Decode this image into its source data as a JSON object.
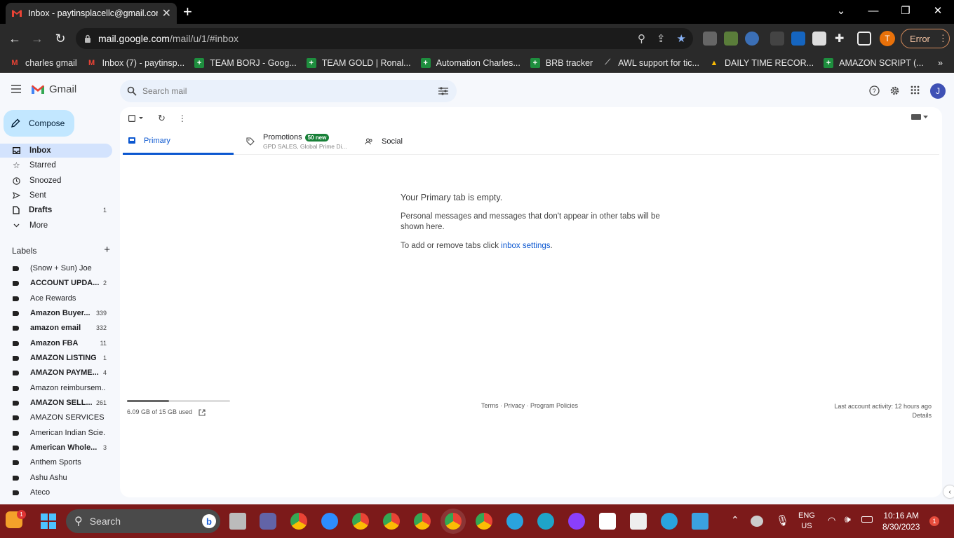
{
  "browser": {
    "tab_title": "Inbox - paytinsplacellc@gmail.com",
    "url_host": "mail.google.com",
    "url_path": "/mail/u/1/#inbox",
    "profile_initial": "T",
    "error_label": "Error",
    "bookmarks": [
      {
        "label": "charles gmail",
        "icon": "gmail-icon"
      },
      {
        "label": "Inbox (7) - paytinsp...",
        "icon": "gmail-icon"
      },
      {
        "label": "TEAM BORJ - Goog...",
        "icon": "sheets-icon"
      },
      {
        "label": "TEAM GOLD | Ronal...",
        "icon": "sheets-icon"
      },
      {
        "label": "Automation Charles...",
        "icon": "sheets-icon"
      },
      {
        "label": "BRB tracker",
        "icon": "sheets-icon"
      },
      {
        "label": "AWL support for tic...",
        "icon": "chart-icon"
      },
      {
        "label": "DAILY TIME RECOR...",
        "icon": "drive-icon"
      },
      {
        "label": "AMAZON SCRIPT (...",
        "icon": "sheets-icon"
      }
    ],
    "more_bookmarks": "»"
  },
  "gmail": {
    "product_name": "Gmail",
    "search_placeholder": "Search mail",
    "avatar_initial": "J",
    "compose_label": "Compose",
    "nav": [
      {
        "label": "Inbox",
        "count": "",
        "active": true,
        "icon": "inbox-icon"
      },
      {
        "label": "Starred",
        "count": "",
        "icon": "star-icon"
      },
      {
        "label": "Snoozed",
        "count": "",
        "icon": "clock-icon"
      },
      {
        "label": "Sent",
        "count": "",
        "icon": "send-icon"
      },
      {
        "label": "Drafts",
        "count": "1",
        "icon": "draft-icon"
      },
      {
        "label": "More",
        "count": "",
        "icon": "chevron-down-icon"
      }
    ],
    "labels_header": "Labels",
    "labels": [
      {
        "label": "(Snow + Sun) Joe",
        "count": "",
        "bold": false
      },
      {
        "label": "ACCOUNT UPDA...",
        "count": "2",
        "bold": true
      },
      {
        "label": "Ace Rewards",
        "count": "",
        "bold": false
      },
      {
        "label": "Amazon Buyer...",
        "count": "339",
        "bold": true
      },
      {
        "label": "amazon email",
        "count": "332",
        "bold": true
      },
      {
        "label": "Amazon FBA",
        "count": "11",
        "bold": true
      },
      {
        "label": "AMAZON LISTING",
        "count": "1",
        "bold": true
      },
      {
        "label": "AMAZON PAYME...",
        "count": "4",
        "bold": true
      },
      {
        "label": "Amazon reimbursem...",
        "count": "",
        "bold": false
      },
      {
        "label": "AMAZON SELL...",
        "count": "261",
        "bold": true
      },
      {
        "label": "AMAZON SERVICES",
        "count": "",
        "bold": false
      },
      {
        "label": "American Indian Scie...",
        "count": "",
        "bold": false
      },
      {
        "label": "American Whole...",
        "count": "3",
        "bold": true
      },
      {
        "label": "Anthem Sports",
        "count": "",
        "bold": false
      },
      {
        "label": "Ashu Ashu",
        "count": "",
        "bold": false
      },
      {
        "label": "Ateco",
        "count": "",
        "bold": false
      }
    ],
    "tabs": {
      "primary": "Primary",
      "promotions": "Promotions",
      "promotions_badge": "50 new",
      "promotions_sub": "GPD SALES, Global Prime Di...",
      "social": "Social"
    },
    "empty": {
      "heading": "Your Primary tab is empty.",
      "body": "Personal messages and messages that don't appear in other tabs will be shown here.",
      "settings_prefix": "To add or remove tabs click ",
      "settings_link": "inbox settings",
      "settings_suffix": "."
    },
    "storage": {
      "text": "6.09 GB of 15 GB used",
      "used_fraction": 0.406
    },
    "footer_links": "Terms · Privacy · Program Policies",
    "last_activity": "Last account activity: 12 hours ago",
    "details": "Details"
  },
  "taskbar": {
    "search_label": "Search",
    "lang_line1": "ENG",
    "lang_line2": "US",
    "time": "10:16 AM",
    "date": "8/30/2023",
    "notif_badge": "1"
  },
  "colors": {
    "accent": "#0b57d0",
    "compose": "#c2e7ff",
    "taskbar": "#7c1a1a"
  }
}
